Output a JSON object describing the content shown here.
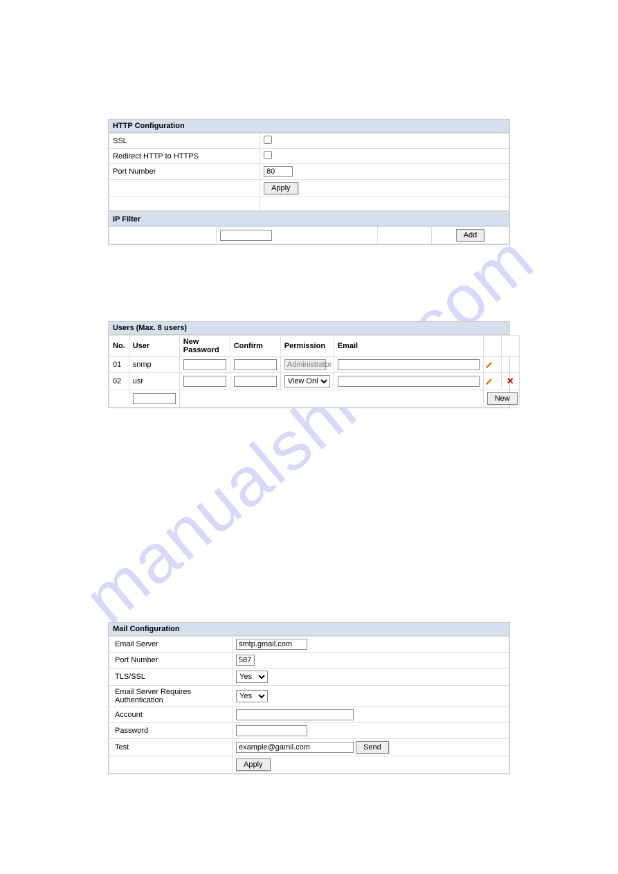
{
  "watermark": "manualshive.com",
  "http_config": {
    "title": "HTTP Configuration",
    "rows": {
      "ssl_label": "SSL",
      "ssl_checked": false,
      "redirect_label": "Redirect HTTP to HTTPS",
      "redirect_checked": false,
      "port_label": "Port Number",
      "port_value": "80"
    },
    "apply_label": "Apply"
  },
  "ip_filter": {
    "title": "IP Filter",
    "input_value": "",
    "add_label": "Add"
  },
  "users": {
    "title": "Users (Max. 8 users)",
    "headers": {
      "no": "No.",
      "user": "User",
      "new_password": "New Password",
      "confirm": "Confirm",
      "permission": "Permission",
      "email": "Email"
    },
    "rows": [
      {
        "no": "01",
        "user": "snmp",
        "new_password": "",
        "confirm": "",
        "permission_fixed": "Administrator",
        "permission_select": null,
        "email": "",
        "has_delete": false
      },
      {
        "no": "02",
        "user": "usr",
        "new_password": "",
        "confirm": "",
        "permission_fixed": null,
        "permission_select": "View Only",
        "email": "",
        "has_delete": true
      }
    ],
    "new_user_value": "",
    "new_label": "New"
  },
  "mail_config": {
    "title": "Mail Configuration",
    "rows": {
      "email_server_label": "Email Server",
      "email_server_value": "smtp.gmail.com",
      "port_label": "Port Number",
      "port_value": "587",
      "tls_label": "TLS/SSL",
      "tls_value": "Yes",
      "auth_label": "Email Server Requires Authentication",
      "auth_value": "Yes",
      "account_label": "Account",
      "account_value": "",
      "password_label": "Password",
      "password_value": "",
      "test_label": "Test",
      "test_value": "example@gamil.com"
    },
    "send_label": "Send",
    "apply_label": "Apply"
  }
}
